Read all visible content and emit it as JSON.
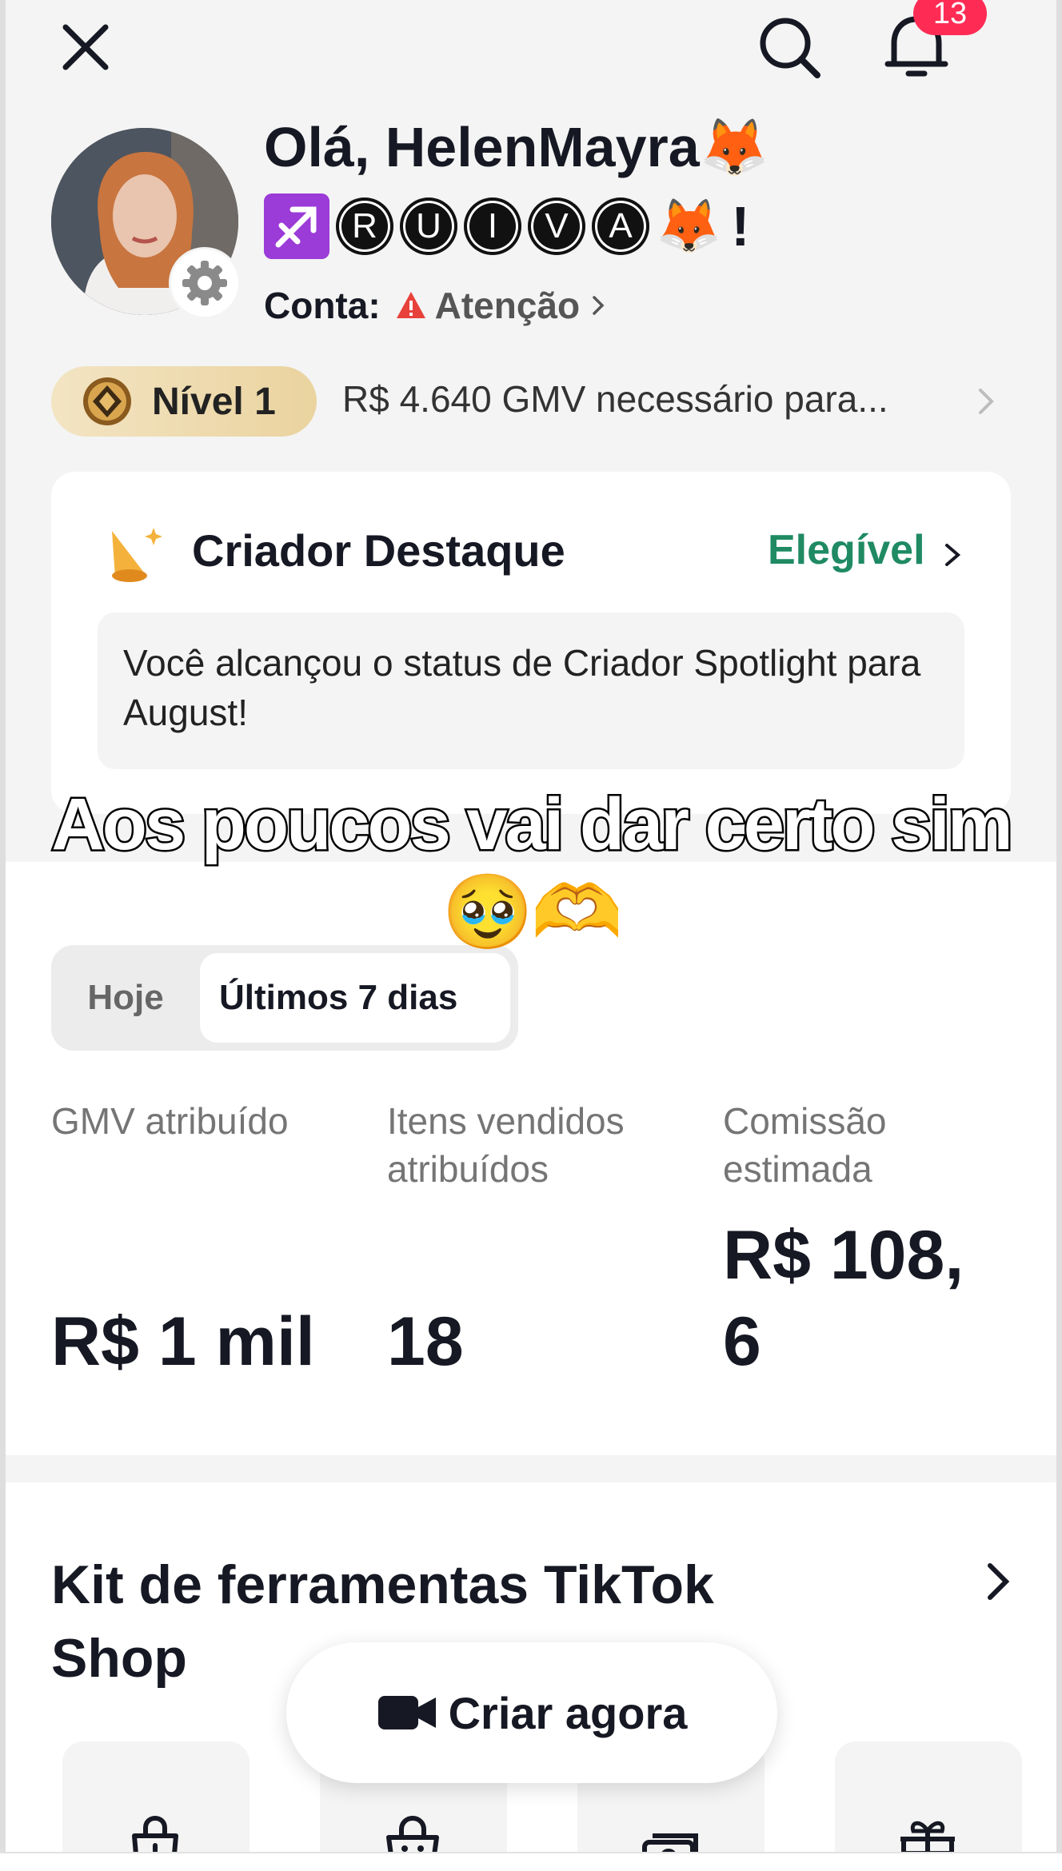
{
  "header": {
    "notification_count": "13"
  },
  "profile": {
    "greeting": "Olá, HelenMayra🦊",
    "name_letters": [
      "R",
      "U",
      "I",
      "V",
      "A"
    ],
    "name_suffix": "🦊",
    "exclamation": "!",
    "account_label": "Conta:",
    "account_status": "Atenção"
  },
  "level": {
    "label": "Nível 1",
    "requirement": "R$ 4.640 GMV necessário para..."
  },
  "spotlight_card": {
    "title": "Criador Destaque",
    "status": "Elegível",
    "note": "Você alcançou o status de Criador Spotlight para August!"
  },
  "overlay": {
    "caption": "Aos poucos vai dar certo sim🥹🫶"
  },
  "period_tabs": {
    "today": "Hoje",
    "last7": "Últimos 7 dias",
    "selected": "Últimos 7 dias"
  },
  "metrics": [
    {
      "label": "GMV atribuído",
      "value": "R$ 1 mil"
    },
    {
      "label": "Itens vendidos atribuídos",
      "value": "18"
    },
    {
      "label": "Comissão estimada",
      "value": "R$ 108, 6"
    }
  ],
  "toolkit": {
    "title": "Kit de ferramentas TikTok Shop",
    "tools": [
      "add-product-icon",
      "shop-bag-icon",
      "money-icon",
      "gift-icon"
    ]
  },
  "cta": {
    "label": "Criar agora"
  },
  "colors": {
    "accent_red": "#fe2c55",
    "eligible_green": "#1f8a63",
    "level_gold": "#ead39f"
  }
}
